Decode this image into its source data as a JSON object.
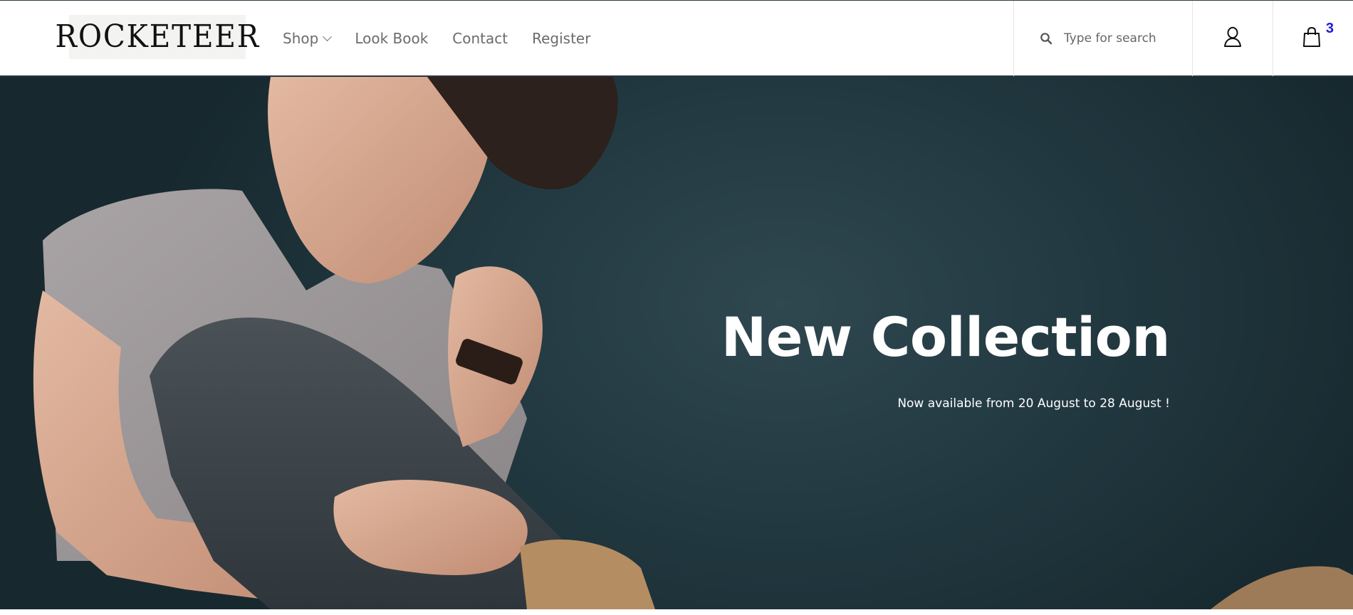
{
  "header": {
    "logo_text": "ROCKETEER",
    "nav": [
      {
        "label": "Shop",
        "has_dropdown": true
      },
      {
        "label": "Look Book",
        "has_dropdown": false
      },
      {
        "label": "Contact",
        "has_dropdown": false
      },
      {
        "label": "Register",
        "has_dropdown": false
      }
    ],
    "search": {
      "placeholder": "Type for search",
      "icon": "search-icon"
    },
    "account_icon": "user-icon",
    "cart": {
      "icon": "shopping-bag-icon",
      "count": "3",
      "count_color": "#1a1ae0"
    }
  },
  "hero": {
    "title": "New Collection",
    "subtitle": "Now available from 20 August to 28 August !",
    "background_color": "#233a42"
  }
}
